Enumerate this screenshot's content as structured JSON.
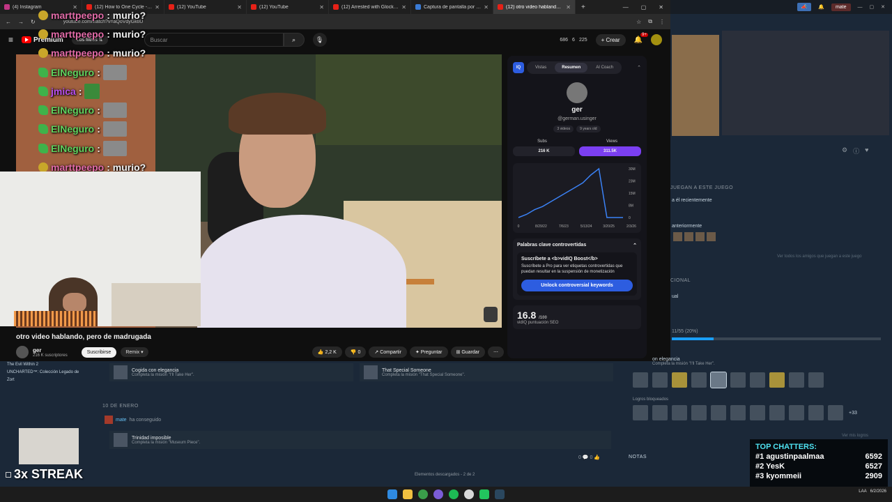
{
  "browser": {
    "tabs": [
      {
        "label": "(4) Instagram",
        "icon": "instagram-icon"
      },
      {
        "label": "(12) How to One Cycle - YouTub",
        "icon": "youtube-icon"
      },
      {
        "label": "(12) YouTube",
        "icon": "youtube-icon"
      },
      {
        "label": "(12) YouTube",
        "icon": "youtube-icon"
      },
      {
        "label": "(12) Arrested with Glock Switch",
        "icon": "youtube-icon"
      },
      {
        "label": "Captura de pantalla por Lightsh",
        "icon": "lightshot-icon"
      },
      {
        "label": "(12) otro video hablando, p",
        "icon": "youtube-icon"
      }
    ],
    "url": "youtube.com/watch?v=aQoVdyGktiU"
  },
  "youtube": {
    "logo_text": "Premium",
    "filters_label": "Los filtros",
    "search_placeholder": "Buscar",
    "header_stats": [
      "686",
      "6",
      "225"
    ],
    "create_label": "Crear",
    "notifications_count": "9+"
  },
  "chat": [
    {
      "user": "marttpeepo",
      "message": ": murio?",
      "color": "pink"
    },
    {
      "user": "marttpeepo",
      "message": ": murio?",
      "color": "pink"
    },
    {
      "user": "marttpeepo",
      "message": ": murio?",
      "color": "pink"
    },
    {
      "user": "ElNeguro",
      "message": ":",
      "color": "green"
    },
    {
      "user": "jmica",
      "message": ":",
      "color": "purple"
    },
    {
      "user": "ElNeguro",
      "message": ":",
      "color": "green"
    },
    {
      "user": "ElNeguro",
      "message": ":",
      "color": "green"
    },
    {
      "user": "ElNeguro",
      "message": ":",
      "color": "green"
    },
    {
      "user": "marttpeepo",
      "message": ": murio?",
      "color": "pink"
    }
  ],
  "video": {
    "title": "otro video hablando, pero de madrugada",
    "channel": "ger",
    "subscribers": "216 K suscriptores",
    "subscribe_label": "Suscribirse",
    "remix_label": "Remix",
    "likes": "2,2 K",
    "dislikes": "0",
    "share_label": "Compartir",
    "ask_label": "Preguntar",
    "save_label": "Guardar"
  },
  "vidiq": {
    "logo": "IQ",
    "tabs": [
      "Vistas",
      "Resumen",
      "AI Coach"
    ],
    "active_tab": "Resumen",
    "name": "ger",
    "handle": "@german.usinger",
    "videos": "3 videos",
    "age": "9 years old",
    "subs_label": "Subs",
    "views_label": "Views",
    "subs_value": "216 K",
    "views_value": "311.5K",
    "kw_title": "Palabras clave controvertidas",
    "kw_heading": "Suscríbete a <b>vidIQ Boost</b>",
    "kw_body": "Suscríbete a Pro para ver etiquetas controvertidas que puedan resultar en la suspensión de monetización",
    "unlock_label": "Unlock controversial keywords",
    "score": "16.8",
    "score_max": "/100",
    "score_label": "vidIQ puntuación SEO"
  },
  "chart_data": {
    "type": "line",
    "x": [
      "0",
      "8/29/22",
      "7/6/23",
      "5/13/24",
      "3/20/25",
      "2/3/26"
    ],
    "y_ticks": [
      "30M",
      "23M",
      "15M",
      "8M",
      "0"
    ],
    "series": [
      {
        "values": [
          0,
          2,
          5,
          7,
          10,
          13,
          16,
          19,
          22,
          27,
          31,
          0,
          0,
          0
        ]
      }
    ],
    "ylim": [
      0,
      31
    ]
  },
  "steam": {
    "topbar_user": "mate",
    "sections": {
      "friends_play": "JUEGAN A ESTE JUEGO",
      "recent": "a él recientemente",
      "previously": "anteriormente",
      "see_all": "Ver todos los amigos que juegan a este juego",
      "additional": "CIONAL",
      "manual": "ual",
      "progress": "11/55 (20%)",
      "ach_name": "on elegancia",
      "ach_desc": "Completa la misión \"I'll Take Her\".",
      "locked": "Logros bloqueados",
      "more": "+33",
      "see_more": "Ver mis logros",
      "notes": "NOTAS"
    },
    "progress_fraction": 0.2,
    "library": [
      "The Evil Within 2",
      "UNCHARTED™: Colección Legado de",
      "Zort"
    ],
    "achievements": [
      {
        "name": "Cogida con elegancia",
        "desc": "Completa la misión \"I'll Take Her\"."
      },
      {
        "name": "That Special Someone",
        "desc": "Completa la misión \"That Special Someone\"."
      }
    ],
    "date_label": "10 DE ENERO",
    "earned_user": "mate",
    "earned_text": "ha conseguido",
    "earned_ach": {
      "name": "Trinidad imposible",
      "desc": "Completa la misión \"Museum Piece\"."
    },
    "counts": "0 💬   0 👍",
    "downloads": "Elementos descargados - 2 de 2"
  },
  "streak": "3x STREAK",
  "top_chatters": {
    "title": "TOP CHATTERS:",
    "rows": [
      {
        "rank": "#1",
        "name": "agustinpaalmaa",
        "count": "6592"
      },
      {
        "rank": "#2",
        "name": "YesK",
        "count": "6527"
      },
      {
        "rank": "#3",
        "name": "kyommeii",
        "count": "2909"
      }
    ]
  },
  "taskbar": {
    "lang": "LAA",
    "date": "6/2/2026"
  }
}
